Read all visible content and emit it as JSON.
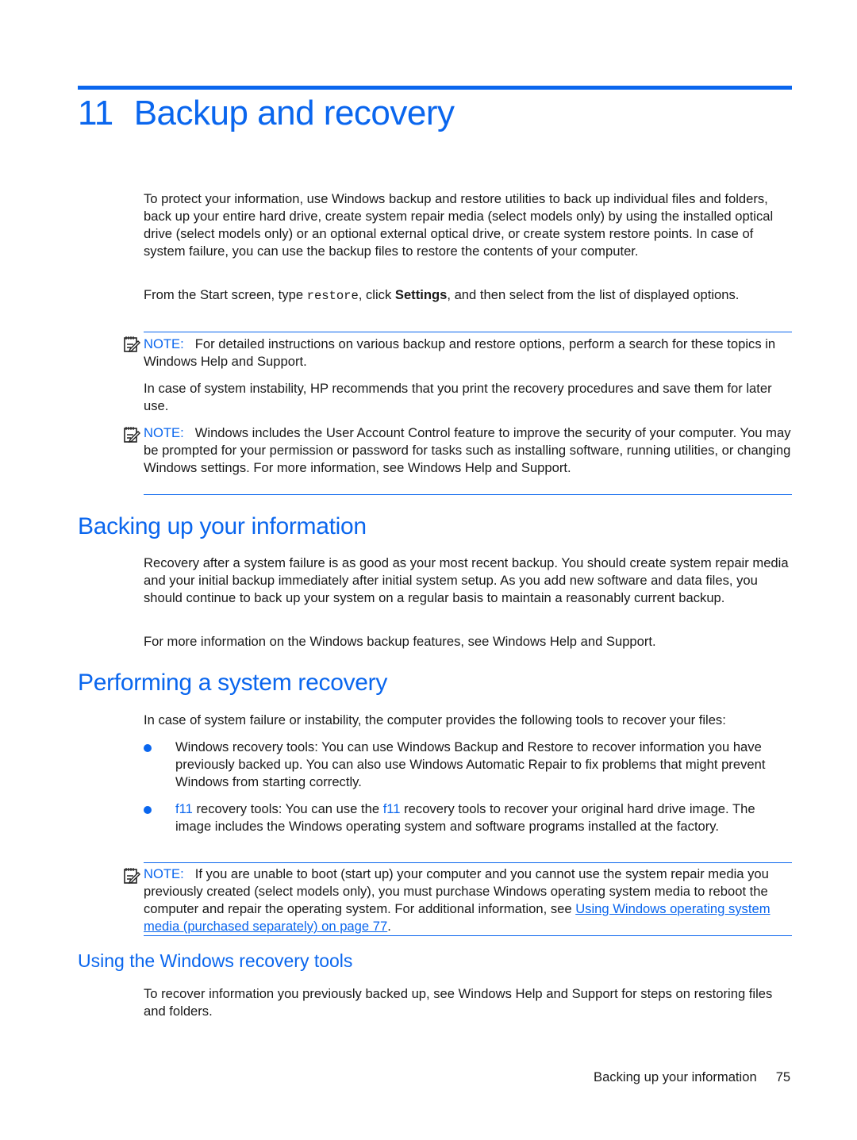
{
  "chapter": {
    "number": "11",
    "title": "Backup and recovery",
    "intro_p1": "To protect your information, use Windows backup and restore utilities to back up individual files and folders, back up your entire hard drive, create system repair media (select models only) by using the installed optical drive (select models only) or an optional external optical drive, or create system restore points. In case of system failure, you can use the backup files to restore the contents of your computer.",
    "intro_p2": {
      "before": "From the Start screen, type ",
      "code": "restore",
      "middle": ", click ",
      "bold": "Settings",
      "after": ", and then select from the list of displayed options."
    },
    "note1": {
      "label": "NOTE:",
      "text": "For detailed instructions on various backup and restore options, perform a search for these topics in Windows Help and Support."
    },
    "p3": "In case of system instability, HP recommends that you print the recovery procedures and save them for later use.",
    "note2": {
      "label": "NOTE:",
      "text": "Windows includes the User Account Control feature to improve the security of your computer. You may be prompted for your permission or password for tasks such as installing software, running utilities, or changing Windows settings. For more information, see Windows Help and Support."
    }
  },
  "section_backing": {
    "title": "Backing up your information",
    "p1": "Recovery after a system failure is as good as your most recent backup. You should create system repair media and your initial backup immediately after initial system setup. As you add new software and data files, you should continue to back up your system on a regular basis to maintain a reasonably current backup.",
    "p2": "For more information on the Windows backup features, see Windows Help and Support."
  },
  "section_recovery": {
    "title": "Performing a system recovery",
    "p1": "In case of system failure or instability, the computer provides the following tools to recover your files:",
    "bullet1": "Windows recovery tools: You can use Windows Backup and Restore to recover information you have previously backed up. You can also use Windows Automatic Repair to fix problems that might prevent Windows from starting correctly.",
    "bullet2": {
      "key1": "f11",
      "text1": " recovery tools: You can use the ",
      "key2": "f11",
      "text2": " recovery tools to recover your original hard drive image. The image includes the Windows operating system and software programs installed at the factory."
    },
    "note3": {
      "label": "NOTE:",
      "text": "If you are unable to boot (start up) your computer and you cannot use the system repair media you previously created (select models only), you must purchase Windows operating system media to reboot the computer and repair the operating system. For additional information, see ",
      "link": "Using Windows operating system media (purchased separately) on page 77",
      "after": "."
    }
  },
  "section_tools": {
    "title": "Using the Windows recovery tools",
    "p1": "To recover information you previously backed up, see Windows Help and Support for steps on restoring files and folders."
  },
  "footer": {
    "section": "Backing up your information",
    "page": "75"
  },
  "colors": {
    "accent": "#0a66ee",
    "text": "#1a1a1a"
  }
}
